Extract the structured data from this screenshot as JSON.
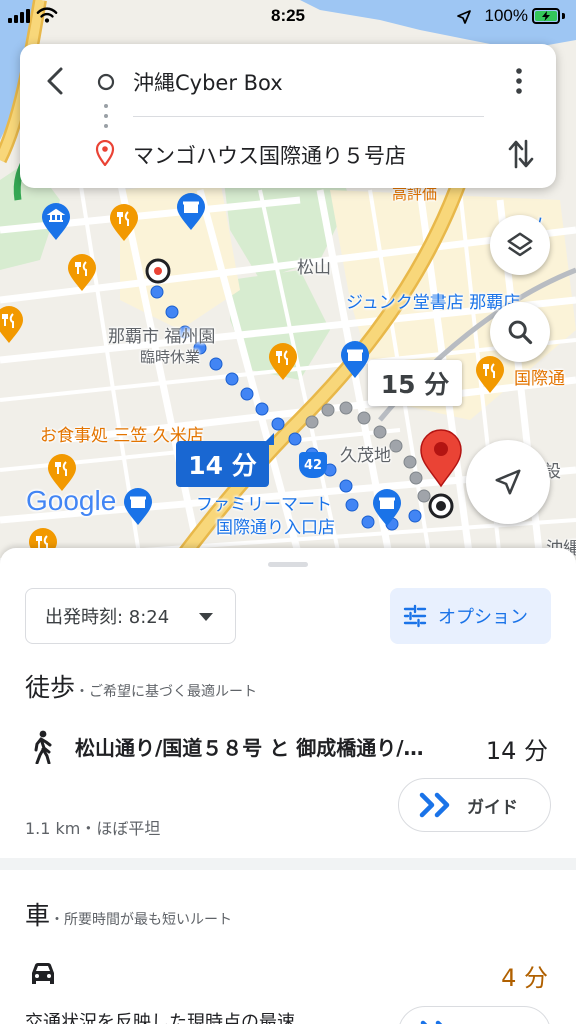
{
  "status_bar": {
    "time": "8:25",
    "battery": "100%"
  },
  "search": {
    "origin": "沖縄Cyber Box",
    "destination": "マンゴハウス国際通り５号店"
  },
  "map": {
    "labels": {
      "matsuyama": "松山",
      "naha_fukushuen": "那覇市 福州園",
      "temp_closed": "臨時休業",
      "junkudo": "ジュンク堂書店 那覇店",
      "kokusai": "国際通",
      "kumoji": "久茂地",
      "shokujidokoro": "お食事処 三笠 久米店",
      "familymart_1": "ファミリーマート",
      "familymart_2": "国際通り入口店",
      "route_42": "42",
      "koshiki": "高評価",
      "google": "Google",
      "edge_so": "ーソ",
      "edge_set": "設",
      "edge_oki": "沖縄"
    },
    "walk_time": "14 分",
    "alt_time": "15 分"
  },
  "sheet": {
    "departure": "出発時刻: 8:24",
    "options": "オプション",
    "walk": {
      "title": "徒歩",
      "subtitle": "・ご希望に基づく最適ルート",
      "route": "松山通り/国道５８号 と 御成橋通り/…",
      "time": "14 分",
      "meta": "1.1 km・ほぼ平坦",
      "guide": "ガイド"
    },
    "car": {
      "title": "車",
      "subtitle": "・所要時間が最も短いルート",
      "time": "4 分",
      "meta": "交通状況を反映した現時点の最速"
    }
  },
  "colors": {
    "accent": "#1a73e8",
    "route_blue": "#4285f4",
    "car_time": "#b06000",
    "pin_red": "#ea4335",
    "highway": "#f6d06b"
  }
}
